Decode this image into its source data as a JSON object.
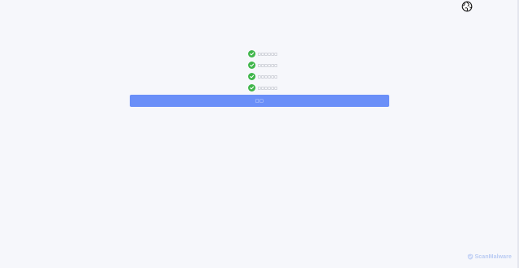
{
  "header": {
    "language_icon": "globe-icon"
  },
  "checklist": [
    {
      "label": "□□□□□□",
      "icon": "check-circle-icon",
      "status": "passed"
    },
    {
      "label": "□□□□□□",
      "icon": "check-circle-icon",
      "status": "passed"
    },
    {
      "label": "□□□□□□",
      "icon": "check-circle-icon",
      "status": "passed"
    },
    {
      "label": "□□□□□□",
      "icon": "check-circle-icon",
      "status": "passed"
    }
  ],
  "action": {
    "button_label": "□□"
  },
  "footer": {
    "brand_name": "ScanMalware",
    "brand_icon": "scanmalware-logo"
  },
  "colors": {
    "background": "#f6f7fb",
    "accent": "#6a8ff8",
    "success": "#3fb64a",
    "brand": "#b9cbf3"
  }
}
